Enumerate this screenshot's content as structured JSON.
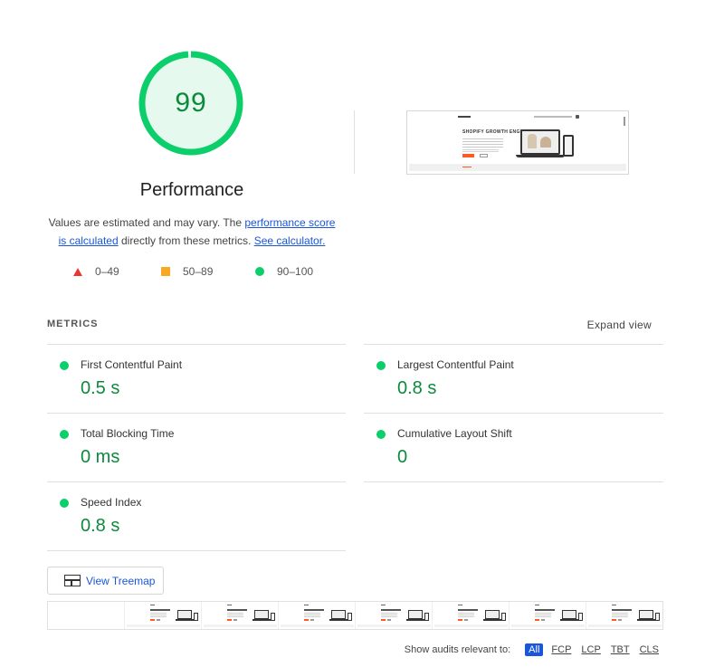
{
  "score": {
    "value": "99",
    "fraction": 0.99,
    "title": "Performance",
    "ring_color": "#0cce6b",
    "fill_color": "#e6f9ee",
    "text_color": "#0c8a3c"
  },
  "description": {
    "prefix": "Values are estimated and may vary. The ",
    "link1": "performance score is calculated",
    "middle": " directly from these metrics. ",
    "link2": "See calculator."
  },
  "legend": [
    {
      "shape": "triangle",
      "range": "0–49",
      "color": "#e53935"
    },
    {
      "shape": "square",
      "range": "50–89",
      "color": "#f9a825"
    },
    {
      "shape": "circle",
      "range": "90–100",
      "color": "#0cce6b"
    }
  ],
  "thumbnail": {
    "headline": "SHOPIFY GROWTH ENGINEER"
  },
  "metrics": {
    "title": "METRICS",
    "expand_label": "Expand view",
    "items": [
      {
        "label": "First Contentful Paint",
        "value": "0.5 s"
      },
      {
        "label": "Largest Contentful Paint",
        "value": "0.8 s"
      },
      {
        "label": "Total Blocking Time",
        "value": "0 ms"
      },
      {
        "label": "Cumulative Layout Shift",
        "value": "0"
      },
      {
        "label": "Speed Index",
        "value": "0.8 s"
      }
    ]
  },
  "treemap": {
    "label": "View Treemap"
  },
  "audit_filter": {
    "label": "Show audits relevant to:",
    "chips": [
      "All",
      "FCP",
      "LCP",
      "TBT",
      "CLS"
    ],
    "active": "All"
  }
}
